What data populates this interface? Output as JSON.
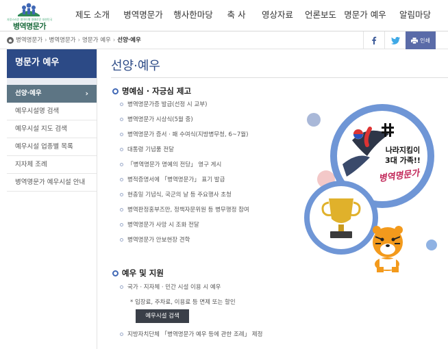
{
  "header": {
    "logo_sub": "자랑스러운 병역이행 명예로운 대한민국",
    "logo_text": "병역명문가",
    "nav": [
      "제도 소개",
      "병역명문가",
      "행사한마당",
      "축 사",
      "영상자료",
      "언론보도",
      "명문가 예우",
      "알림마당"
    ]
  },
  "breadcrumb": {
    "items": [
      "병역명문가",
      "병역명문가",
      "명문가 예우"
    ],
    "current": "선양·예우",
    "print_label": "인쇄",
    "share_icons": [
      "facebook-icon",
      "twitter-icon",
      "print-icon"
    ]
  },
  "sidebar": {
    "title": "명문가 예우",
    "items": [
      {
        "label": "선양·예우",
        "active": true
      },
      {
        "label": "예우시설명 검색",
        "active": false
      },
      {
        "label": "예우시설 지도 검색",
        "active": false
      },
      {
        "label": "예우시설 업종별 목록",
        "active": false
      },
      {
        "label": "지자체 조례",
        "active": false
      },
      {
        "label": "병역명문가 예우시설 안내",
        "active": false
      }
    ]
  },
  "main": {
    "title": "선양·예우",
    "section1": {
      "heading": "명예심 · 자긍심 제고",
      "items": [
        "병역명문가증 발급(선정 시 교부)",
        "병역명문가 시상식(5월 중)",
        "병역명문가 증서 · 패 수여식(지방병무청, 6~7월)",
        "대통령 기념품 전달",
        "「병역명문가 명예의 전당」 영구 게시",
        "병적증명서에 「병역명문가」 표기 발급",
        "현충일 기념식, 국군의 날 등 주요행사 초청",
        "병역판정홍부즈만, 정책자문위원 등 병무행정 참여",
        "병역명문가 사망 시 조화 전달",
        "병역명문가 안보현장 견학"
      ]
    },
    "section2": {
      "heading": "예우 및 지원",
      "items": [
        "국가 · 지자체 · 민간 시설 이용 시 예우",
        "지방자치단체 「병역명문가 예우 등에 관한 조례」 제정"
      ],
      "note": "* 입장료, 주차료, 이용료 등 면제 또는 할인",
      "button": "예우시설 검색"
    },
    "illustration": {
      "line1": "나라지킴이",
      "line2": "3대 가족!!",
      "calligraphy": "병역명문가"
    }
  },
  "colors": {
    "brand_navy": "#2c4a86",
    "sidebar_active": "#5d7584",
    "print_button": "#5a6ba8",
    "bubble_blue": "#6f96d6",
    "logo_green": "#1a6b3c"
  }
}
